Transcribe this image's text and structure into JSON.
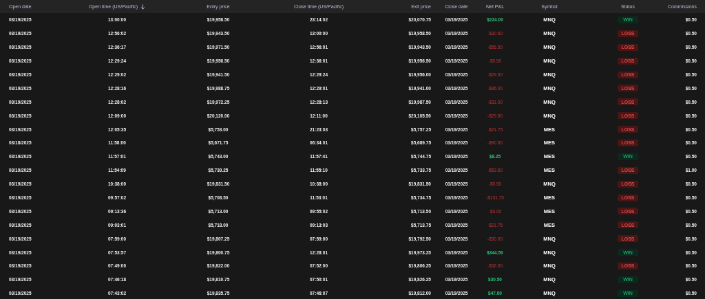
{
  "table": {
    "columns": [
      {
        "label": "Open date",
        "sorted": false
      },
      {
        "label": "Open time (US/Pacific)",
        "sorted": true
      },
      {
        "label": "Entry price",
        "sorted": false
      },
      {
        "label": "Close time (US/Pacific)",
        "sorted": false
      },
      {
        "label": "Exit price",
        "sorted": false
      },
      {
        "label": "Close date",
        "sorted": false
      },
      {
        "label": "Net P&L",
        "sorted": false
      },
      {
        "label": "Symbol",
        "sorted": false
      },
      {
        "label": "Status",
        "sorted": false
      },
      {
        "label": "Commissions",
        "sorted": false
      }
    ],
    "rows": [
      {
        "open_date": "03/19/2025",
        "open_time": "13:00:00",
        "entry_price": "$19,958.50",
        "close_time": "23:14:02",
        "exit_price": "$20,070.75",
        "close_date": "03/19/2025",
        "net_pnl": "$224.00",
        "symbol": "MNQ",
        "status": "WIN",
        "win": true,
        "commissions": "$0.50"
      },
      {
        "open_date": "03/19/2025",
        "open_time": "12:56:02",
        "entry_price": "$19,943.50",
        "close_time": "13:00:00",
        "exit_price": "$19,958.50",
        "close_date": "03/19/2025",
        "net_pnl": "-$30.50",
        "symbol": "MNQ",
        "status": "LOSS",
        "win": false,
        "commissions": "$0.50"
      },
      {
        "open_date": "03/19/2025",
        "open_time": "12:36:17",
        "entry_price": "$19,971.50",
        "close_time": "12:56:01",
        "exit_price": "$19,943.50",
        "close_date": "03/19/2025",
        "net_pnl": "-$56.50",
        "symbol": "MNQ",
        "status": "LOSS",
        "win": false,
        "commissions": "$0.50"
      },
      {
        "open_date": "03/19/2025",
        "open_time": "12:29:24",
        "entry_price": "$19,956.50",
        "close_time": "12:36:01",
        "exit_price": "$19,956.50",
        "close_date": "03/19/2025",
        "net_pnl": "-$0.50",
        "symbol": "MNQ",
        "status": "LOSS",
        "win": false,
        "commissions": "$0.50"
      },
      {
        "open_date": "03/19/2025",
        "open_time": "12:29:02",
        "entry_price": "$19,941.50",
        "close_time": "12:29:24",
        "exit_price": "$19,956.00",
        "close_date": "03/19/2025",
        "net_pnl": "-$29.50",
        "symbol": "MNQ",
        "status": "LOSS",
        "win": false,
        "commissions": "$0.50"
      },
      {
        "open_date": "03/19/2025",
        "open_time": "12:28:16",
        "entry_price": "$19,988.75",
        "close_time": "12:29:01",
        "exit_price": "$19,941.00",
        "close_date": "03/19/2025",
        "net_pnl": "-$96.00",
        "symbol": "MNQ",
        "status": "LOSS",
        "win": false,
        "commissions": "$0.50"
      },
      {
        "open_date": "03/19/2025",
        "open_time": "12:28:02",
        "entry_price": "$19,972.25",
        "close_time": "12:28:13",
        "exit_price": "$19,987.50",
        "close_date": "03/19/2025",
        "net_pnl": "-$31.00",
        "symbol": "MNQ",
        "status": "LOSS",
        "win": false,
        "commissions": "$0.50"
      },
      {
        "open_date": "03/19/2025",
        "open_time": "12:09:00",
        "entry_price": "$20,120.00",
        "close_time": "12:11:00",
        "exit_price": "$20,105.50",
        "close_date": "03/19/2025",
        "net_pnl": "-$29.50",
        "symbol": "MNQ",
        "status": "LOSS",
        "win": false,
        "commissions": "$0.50"
      },
      {
        "open_date": "03/19/2025",
        "open_time": "12:05:35",
        "entry_price": "$5,753.00",
        "close_time": "21:23:03",
        "exit_price": "$5,757.25",
        "close_date": "03/19/2025",
        "net_pnl": "-$21.75",
        "symbol": "MES",
        "status": "LOSS",
        "win": false,
        "commissions": "$0.50"
      },
      {
        "open_date": "03/18/2025",
        "open_time": "11:58:00",
        "entry_price": "$5,671.75",
        "close_time": "06:34:01",
        "exit_price": "$5,689.75",
        "close_date": "03/19/2025",
        "net_pnl": "-$90.50",
        "symbol": "MES",
        "status": "LOSS",
        "win": false,
        "commissions": "$0.50"
      },
      {
        "open_date": "03/19/2025",
        "open_time": "11:57:01",
        "entry_price": "$5,743.00",
        "close_time": "11:57:41",
        "exit_price": "$5,744.75",
        "close_date": "03/19/2025",
        "net_pnl": "$8.25",
        "symbol": "MES",
        "status": "WIN",
        "win": true,
        "commissions": "$0.50"
      },
      {
        "open_date": "03/19/2025",
        "open_time": "11:54:09",
        "entry_price": "$5,739.25",
        "close_time": "11:55:10",
        "exit_price": "$5,733.75",
        "close_date": "03/19/2025",
        "net_pnl": "-$53.50",
        "symbol": "MES",
        "status": "LOSS",
        "win": false,
        "commissions": "$1.00"
      },
      {
        "open_date": "03/19/2025",
        "open_time": "10:38:00",
        "entry_price": "$19,831.50",
        "close_time": "10:38:00",
        "exit_price": "$19,831.50",
        "close_date": "03/19/2025",
        "net_pnl": "-$0.50",
        "symbol": "MNQ",
        "status": "LOSS",
        "win": false,
        "commissions": "$0.50"
      },
      {
        "open_date": "03/19/2025",
        "open_time": "09:57:02",
        "entry_price": "$5,708.50",
        "close_time": "11:53:01",
        "exit_price": "$5,734.75",
        "close_date": "03/19/2025",
        "net_pnl": "-$131.75",
        "symbol": "MES",
        "status": "LOSS",
        "win": false,
        "commissions": "$0.50"
      },
      {
        "open_date": "03/19/2025",
        "open_time": "09:13:36",
        "entry_price": "$5,713.00",
        "close_time": "09:55:02",
        "exit_price": "$5,713.50",
        "close_date": "03/19/2025",
        "net_pnl": "-$3.00",
        "symbol": "MES",
        "status": "LOSS",
        "win": false,
        "commissions": "$0.50"
      },
      {
        "open_date": "03/19/2025",
        "open_time": "09:03:01",
        "entry_price": "$5,718.00",
        "close_time": "09:13:03",
        "exit_price": "$5,713.75",
        "close_date": "03/19/2025",
        "net_pnl": "-$21.75",
        "symbol": "MES",
        "status": "LOSS",
        "win": false,
        "commissions": "$0.50"
      },
      {
        "open_date": "03/19/2025",
        "open_time": "07:59:00",
        "entry_price": "$19,807.25",
        "close_time": "07:59:00",
        "exit_price": "$19,792.50",
        "close_date": "03/19/2025",
        "net_pnl": "-$30.00",
        "symbol": "MNQ",
        "status": "LOSS",
        "win": false,
        "commissions": "$0.50"
      },
      {
        "open_date": "03/19/2025",
        "open_time": "07:53:57",
        "entry_price": "$19,800.75",
        "close_time": "12:28:01",
        "exit_price": "$19,973.25",
        "close_date": "03/19/2025",
        "net_pnl": "$344.50",
        "symbol": "MNQ",
        "status": "WIN",
        "win": true,
        "commissions": "$0.50"
      },
      {
        "open_date": "03/19/2025",
        "open_time": "07:49:00",
        "entry_price": "$19,822.00",
        "close_time": "07:52:00",
        "exit_price": "$19,806.25",
        "close_date": "03/19/2025",
        "net_pnl": "-$32.00",
        "symbol": "MNQ",
        "status": "LOSS",
        "win": false,
        "commissions": "$0.50"
      },
      {
        "open_date": "03/19/2025",
        "open_time": "07:46:18",
        "entry_price": "$19,810.75",
        "close_time": "07:50:01",
        "exit_price": "$19,826.25",
        "close_date": "03/19/2025",
        "net_pnl": "$30.50",
        "symbol": "MNQ",
        "status": "WIN",
        "win": true,
        "commissions": "$0.50"
      },
      {
        "open_date": "03/19/2025",
        "open_time": "07:43:02",
        "entry_price": "$19,835.75",
        "close_time": "07:46:07",
        "exit_price": "$19,812.00",
        "close_date": "03/19/2025",
        "net_pnl": "$47.00",
        "symbol": "MNQ",
        "status": "WIN",
        "win": true,
        "commissions": "$0.50"
      }
    ]
  }
}
